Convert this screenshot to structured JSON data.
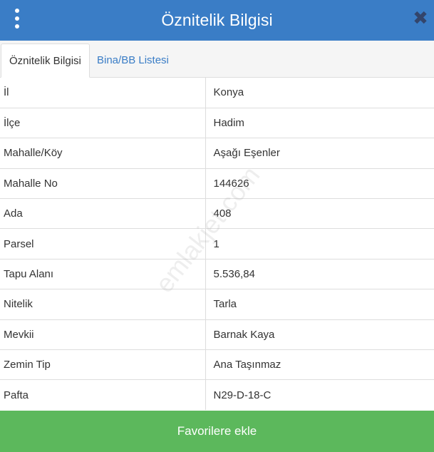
{
  "header": {
    "title": "Öznitelik Bilgisi",
    "menu_icon": "kebab-menu-icon",
    "close_icon": "close-icon",
    "close_glyph": "✖"
  },
  "tabs": [
    {
      "label": "Öznitelik Bilgisi",
      "active": true
    },
    {
      "label": "Bina/BB Listesi",
      "active": false
    }
  ],
  "attributes": [
    {
      "key": "İl",
      "value": "Konya"
    },
    {
      "key": "İlçe",
      "value": "Hadim"
    },
    {
      "key": "Mahalle/Köy",
      "value": "Aşağı Eşenler"
    },
    {
      "key": "Mahalle No",
      "value": "144626"
    },
    {
      "key": "Ada",
      "value": "408"
    },
    {
      "key": "Parsel",
      "value": "1"
    },
    {
      "key": "Tapu Alanı",
      "value": "5.536,84"
    },
    {
      "key": "Nitelik",
      "value": "Tarla"
    },
    {
      "key": "Mevkii",
      "value": "Barnak Kaya"
    },
    {
      "key": "Zemin Tip",
      "value": "Ana Taşınmaz"
    },
    {
      "key": "Pafta",
      "value": "N29-D-18-C"
    }
  ],
  "watermark": "emlakjet.com",
  "footer": {
    "favorite_label": "Favorilere ekle"
  },
  "colors": {
    "header": "#3a7dc6",
    "tab_link": "#3a7dc6",
    "favorite_button": "#5cb85c",
    "close_icon": "#33456b"
  }
}
